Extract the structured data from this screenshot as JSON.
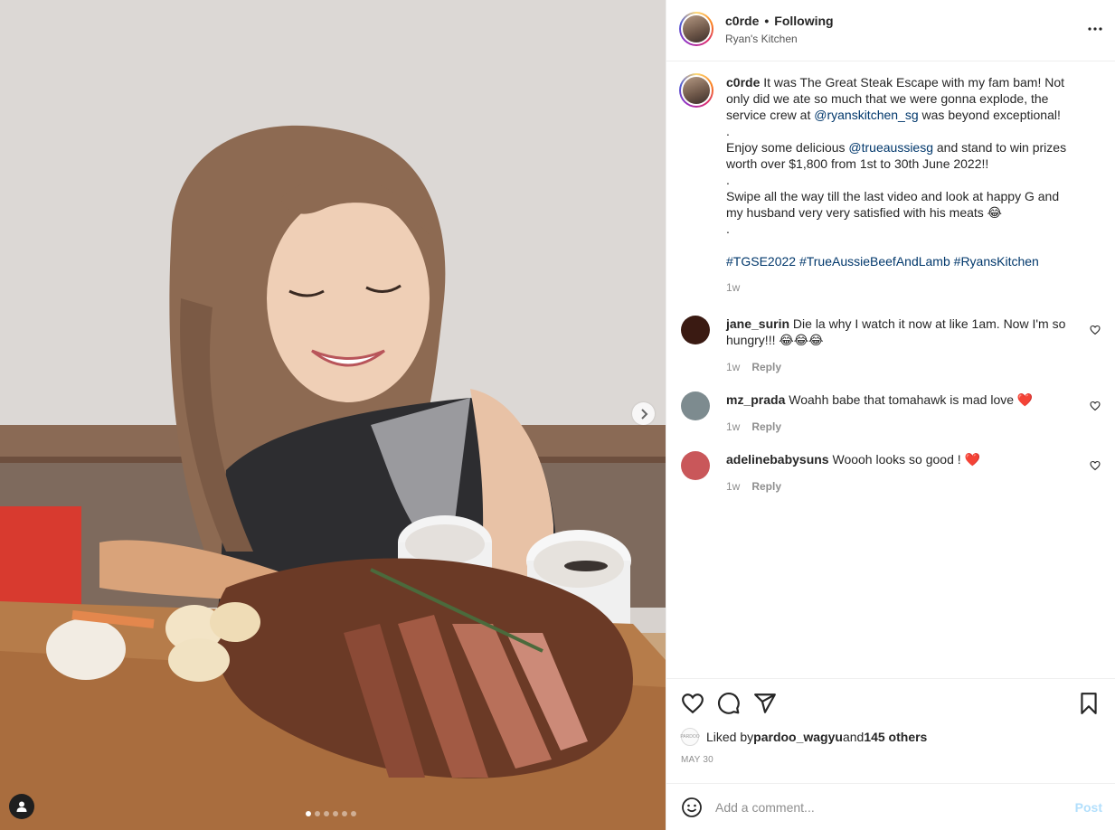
{
  "header": {
    "username": "c0rde",
    "separator": "•",
    "follow_status": "Following",
    "location": "Ryan's Kitchen",
    "more_icon": "ellipsis-icon"
  },
  "caption": {
    "username": "c0rde",
    "line1": "It was The Great Steak Escape with my fam bam! Not only did we ate so much that we were gonna explode, the service crew at ",
    "mention1": "@ryanskitchen_sg",
    "line1_end": " was beyond exceptional!",
    "dot1": ".",
    "line2_start": "Enjoy some delicious ",
    "mention2": "@trueaussiesg",
    "line2_end": " and stand to win prizes worth over $1,800 from 1st to 30th June 2022!!",
    "dot2": ".",
    "line3": "Swipe all the way till the last video and look at happy G and my husband very very satisfied with his meats 😂",
    "dot3": ".",
    "hashtags": [
      "#TGSE2022",
      "#TrueAussieBeefAndLamb",
      "#RyansKitchen"
    ],
    "time": "1w"
  },
  "comments": [
    {
      "username": "jane_surin",
      "text": "Die la why I watch it now at like 1am. Now I'm so hungry!!! 😂😂😂",
      "time": "1w",
      "reply_label": "Reply",
      "avatar_color": "#3a1a12"
    },
    {
      "username": "mz_prada",
      "text": "Woahh babe that tomahawk is mad love ❤️",
      "time": "1w",
      "reply_label": "Reply",
      "avatar_color": "#7d8b8f"
    },
    {
      "username": "adelinebabysuns",
      "text": "Woooh looks so good ! ❤️",
      "time": "1w",
      "reply_label": "Reply",
      "avatar_color": "#c9575a"
    }
  ],
  "actions": {
    "icons": [
      "heart-icon",
      "comment-icon",
      "share-icon",
      "bookmark-icon"
    ]
  },
  "likes": {
    "prefix": "Liked by ",
    "first_liker": "pardoo_wagyu",
    "middle": " and ",
    "others": "145 others",
    "mini_avatar_text": "PARDOO"
  },
  "date": "MAY 30",
  "add_comment": {
    "placeholder": "Add a comment...",
    "post_label": "Post"
  },
  "carousel": {
    "total": 6,
    "active_index": 0
  },
  "colors": {
    "link": "#00376b",
    "muted": "#8e8e8e",
    "post_button_disabled": "#b2dffc"
  }
}
